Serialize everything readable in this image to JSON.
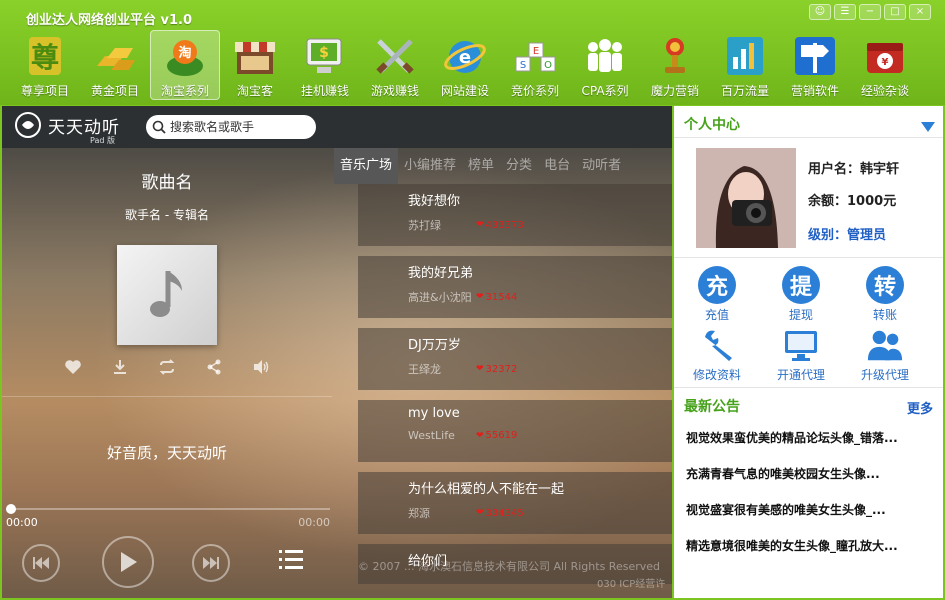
{
  "app": {
    "title": "创业达人网络创业平台 v1.0"
  },
  "window_controls": [
    "☺",
    "☰",
    "−",
    "□",
    "×"
  ],
  "nav": [
    {
      "label": "尊享项目",
      "icon": "zun-icon"
    },
    {
      "label": "黄金项目",
      "icon": "gold-bars-icon"
    },
    {
      "label": "淘宝系列",
      "icon": "taobao-icon",
      "active": true
    },
    {
      "label": "淘宝客",
      "icon": "shop-icon"
    },
    {
      "label": "挂机赚钱",
      "icon": "money-computer-icon"
    },
    {
      "label": "游戏赚钱",
      "icon": "swords-icon"
    },
    {
      "label": "网站建设",
      "icon": "ie-icon"
    },
    {
      "label": "竞价系列",
      "icon": "seo-cubes-icon"
    },
    {
      "label": "CPA系列",
      "icon": "people-icon"
    },
    {
      "label": "魔力营销",
      "icon": "trophy-icon"
    },
    {
      "label": "百万流量",
      "icon": "bar-chart-icon"
    },
    {
      "label": "营销软件",
      "icon": "signpost-icon"
    },
    {
      "label": "经验杂谈",
      "icon": "gift-icon"
    }
  ],
  "player": {
    "logo_name": "天天动听",
    "logo_sub": "Pad 版",
    "search_placeholder": "搜索歌名或歌手",
    "song_title": "歌曲名",
    "song_meta": "歌手名 - 专辑名",
    "slogan": "好音质，天天动听",
    "time_current": "00:00",
    "time_total": "00:00",
    "progress": 0,
    "tabs": [
      "音乐广场",
      "小编推荐",
      "榜单",
      "分类",
      "电台",
      "动听者"
    ],
    "songs": [
      {
        "name": "我好想你",
        "artist": "苏打绿",
        "likes": "433373"
      },
      {
        "name": "我的好兄弟",
        "artist": "高进&小沈阳",
        "likes": "31544"
      },
      {
        "name": "DJ万万岁",
        "artist": "王绎龙",
        "likes": "32372"
      },
      {
        "name": "my love",
        "artist": "WestLife",
        "likes": "55619"
      },
      {
        "name": "为什么相爱的人不能在一起",
        "artist": "郑源",
        "likes": "334345"
      },
      {
        "name": "给你们",
        "artist": "",
        "likes": ""
      }
    ],
    "footer": "© 2007 ... 海水澳石信息技术有限公司 All Rights Reserved",
    "footer2": "030 ICP经营许"
  },
  "personal": {
    "title": "个人中心",
    "username_label": "用户名：",
    "username": "韩宇轩",
    "balance_label": "余额：",
    "balance": "1000元",
    "level_label": "级别：",
    "level": "管理员",
    "actions": [
      {
        "glyph": "充",
        "label": "充值"
      },
      {
        "glyph": "提",
        "label": "提现"
      },
      {
        "glyph": "转",
        "label": "转账"
      },
      {
        "glyph": "",
        "label": "修改资料"
      },
      {
        "glyph": "",
        "label": "开通代理"
      },
      {
        "glyph": "",
        "label": "升级代理"
      }
    ]
  },
  "notices": {
    "title": "最新公告",
    "more": "更多",
    "items": [
      "视觉效果蛮优美的精品论坛头像_错落...",
      "充满青春气息的唯美校园女生头像...",
      "视觉盛宴很有美感的唯美女生头像_...",
      "精选意境很唯美的女生头像_瞳孔放大..."
    ]
  },
  "colors": {
    "brand_green": "#7cc520",
    "title_green": "#46a21a",
    "link_blue": "#1f5fc4",
    "heart_red": "#e0201a"
  }
}
